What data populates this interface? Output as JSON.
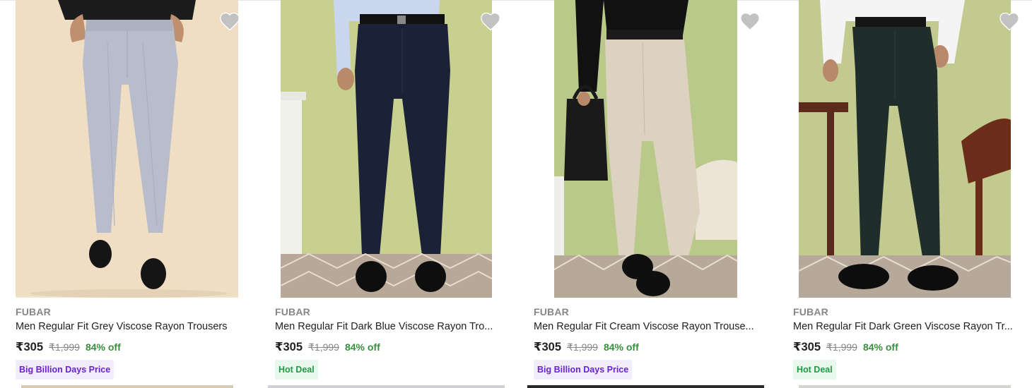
{
  "products": [
    {
      "brand": "FUBAR",
      "title": "Men Regular Fit Grey Viscose Rayon Trousers",
      "price": "₹305",
      "mrp": "₹1,999",
      "discount": "84% off",
      "badge": "Big Billion Days Price",
      "badge_type": "purple",
      "image_alt": "grey trousers photo",
      "colors": {
        "background": "#f2e3cc",
        "garment": "#b9bdcb",
        "shirt": "#1c1c1c"
      }
    },
    {
      "brand": "FUBAR",
      "title": "Men Regular Fit Dark Blue Viscose Rayon Tro...",
      "price": "₹305",
      "mrp": "₹1,999",
      "discount": "84% off",
      "badge": "Hot Deal",
      "badge_type": "green",
      "image_alt": "dark blue trousers photo",
      "colors": {
        "background": "#c7d08e",
        "garment": "#1b2237",
        "shirt": "#c9d6ee"
      }
    },
    {
      "brand": "FUBAR",
      "title": "Men Regular Fit Cream Viscose Rayon Trouse...",
      "price": "₹305",
      "mrp": "₹1,999",
      "discount": "84% off",
      "badge": "Big Billion Days Price",
      "badge_type": "purple",
      "image_alt": "cream trousers photo",
      "colors": {
        "background": "#b9c98a",
        "garment": "#ddd2bf",
        "shirt": "#111111"
      }
    },
    {
      "brand": "FUBAR",
      "title": "Men Regular Fit Dark Green Viscose Rayon Tr...",
      "price": "₹305",
      "mrp": "₹1,999",
      "discount": "84% off",
      "badge": "Hot Deal",
      "badge_type": "green",
      "image_alt": "dark green trousers photo",
      "colors": {
        "background": "#c2ca90",
        "garment": "#1f2e2b",
        "shirt": "#f4f4f4"
      }
    }
  ],
  "icons": {
    "wishlist": "heart-icon"
  },
  "colors": {
    "accent": "#2874f0",
    "price_text": "#212121",
    "discount_green": "#388e3c",
    "muted": "#878787",
    "wishlist_heart": "#c2c2c2"
  }
}
